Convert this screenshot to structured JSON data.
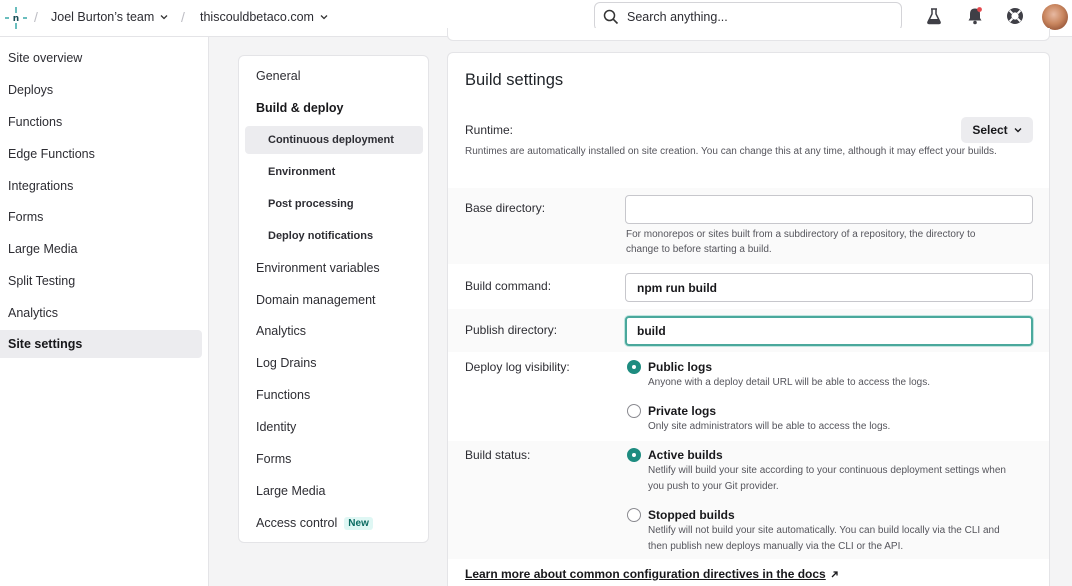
{
  "topbar": {
    "team": "Joel Burton’s team",
    "site": "thiscouldbetaco.com",
    "search_placeholder": "Search anything...",
    "icons": [
      "netlify-logo-icon",
      "labs-flask-icon",
      "notifications-bell-icon",
      "help-lifebuoy-icon",
      "user-avatar"
    ]
  },
  "sidebar": {
    "items": [
      {
        "label": "Site overview"
      },
      {
        "label": "Deploys"
      },
      {
        "label": "Functions"
      },
      {
        "label": "Edge Functions"
      },
      {
        "label": "Integrations"
      },
      {
        "label": "Forms"
      },
      {
        "label": "Large Media"
      },
      {
        "label": "Split Testing"
      },
      {
        "label": "Analytics"
      },
      {
        "label": "Site settings",
        "active": true
      }
    ]
  },
  "subnav": {
    "items": [
      {
        "label": "General"
      },
      {
        "label": "Build & deploy",
        "expanded": true
      },
      {
        "label": "Continuous deployment",
        "active": true
      },
      {
        "label": "Environment"
      },
      {
        "label": "Post processing"
      },
      {
        "label": "Deploy notifications"
      },
      {
        "label": "Environment variables"
      },
      {
        "label": "Domain management"
      },
      {
        "label": "Analytics"
      },
      {
        "label": "Log Drains"
      },
      {
        "label": "Functions"
      },
      {
        "label": "Identity"
      },
      {
        "label": "Forms"
      },
      {
        "label": "Large Media"
      },
      {
        "label": "Access control",
        "badge": "New"
      }
    ]
  },
  "build_settings": {
    "title": "Build settings",
    "runtime": {
      "label": "Runtime:",
      "select_label": "Select",
      "help": "Runtimes are automatically installed on site creation. You can change this at any time, although it may effect your builds."
    },
    "base_directory": {
      "label": "Base directory:",
      "value": "",
      "help_line1": "For monorepos or sites built from a subdirectory of a repository, the directory to",
      "help_line2": "change to before starting a build."
    },
    "build_command": {
      "label": "Build command:",
      "value": "npm run build"
    },
    "publish_directory": {
      "label": "Publish directory:",
      "value": "build"
    },
    "deploy_log_visibility": {
      "label": "Deploy log visibility:",
      "options": [
        {
          "title": "Public logs",
          "desc": "Anyone with a deploy detail URL will be able to access the logs.",
          "selected": true
        },
        {
          "title": "Private logs",
          "desc": "Only site administrators will be able to access the logs.",
          "selected": false
        }
      ]
    },
    "build_status": {
      "label": "Build status:",
      "options": [
        {
          "title": "Active builds",
          "desc_line1": "Netlify will build your site according to your continuous deployment settings when",
          "desc_line2": "you push to your Git provider.",
          "selected": true
        },
        {
          "title": "Stopped builds",
          "desc_line1": "Netlify will not build your site automatically. You can build locally via the CLI and",
          "desc_line2": "then publish new deploys manually via the CLI or the API.",
          "selected": false
        }
      ]
    },
    "docs_link": "Learn more about common configuration directives in the docs"
  },
  "colors": {
    "accent_teal": "#1e8c80",
    "focus_ring": "#4aa89c"
  }
}
